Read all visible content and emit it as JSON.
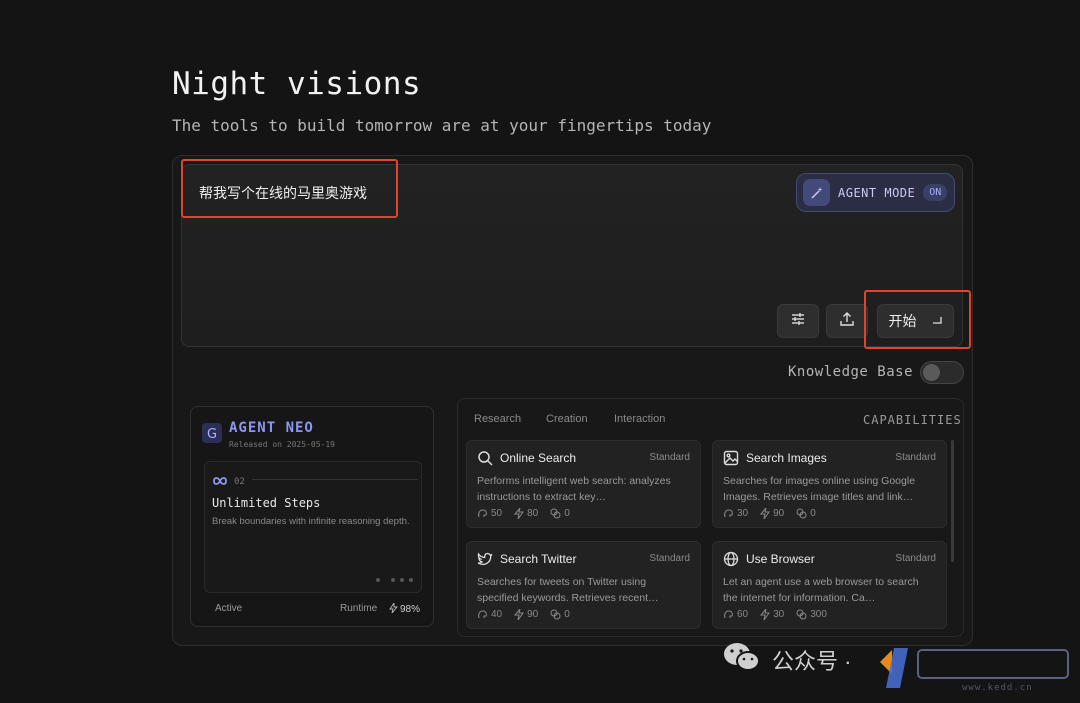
{
  "header": {
    "title": "Night visions",
    "subtitle": "The tools to build tomorrow are at your fingertips today"
  },
  "prompt": {
    "text": "帮我写个在线的马里奥游戏",
    "agent_mode_label": "AGENT MODE",
    "agent_mode_state": "ON",
    "start_label": "开始"
  },
  "knowledge_base": {
    "label": "Knowledge Base",
    "enabled": false
  },
  "agent": {
    "name": "AGENT NEO",
    "released": "Released on 2025-05-19",
    "step_number": "02",
    "step_title": "Unlimited Steps",
    "step_desc": "Break boundaries with infinite reasoning depth.",
    "status": "Active",
    "runtime_label": "Runtime",
    "runtime_value": "98%"
  },
  "capabilities": {
    "tabs": [
      "Research",
      "Creation",
      "Interaction"
    ],
    "heading": "CAPABILITIES",
    "cards": [
      {
        "name": "Online Search",
        "tier": "Standard",
        "icon": "search-icon",
        "desc": "Performs intelligent web search: analyzes instructions to extract key…",
        "stats": [
          "50",
          "80",
          "0"
        ]
      },
      {
        "name": "Search Images",
        "tier": "Standard",
        "icon": "image-icon",
        "desc": "Searches for images online using Google Images. Retrieves image titles and link…",
        "stats": [
          "30",
          "90",
          "0"
        ]
      },
      {
        "name": "Search Twitter",
        "tier": "Standard",
        "icon": "twitter-icon",
        "desc": "Searches for tweets on Twitter using specified keywords. Retrieves recent…",
        "stats": [
          "40",
          "90",
          "0"
        ]
      },
      {
        "name": "Use Browser",
        "tier": "Standard",
        "icon": "globe-icon",
        "desc": "Let an agent use a web browser to search the internet for information. Ca…",
        "stats": [
          "60",
          "30",
          "300"
        ]
      }
    ]
  },
  "watermark": {
    "text": "公众号 ·",
    "site": "www.kedd.cn"
  },
  "colors": {
    "highlight": "#e0432e",
    "accent": "#8f96f2",
    "background": "#141414"
  }
}
